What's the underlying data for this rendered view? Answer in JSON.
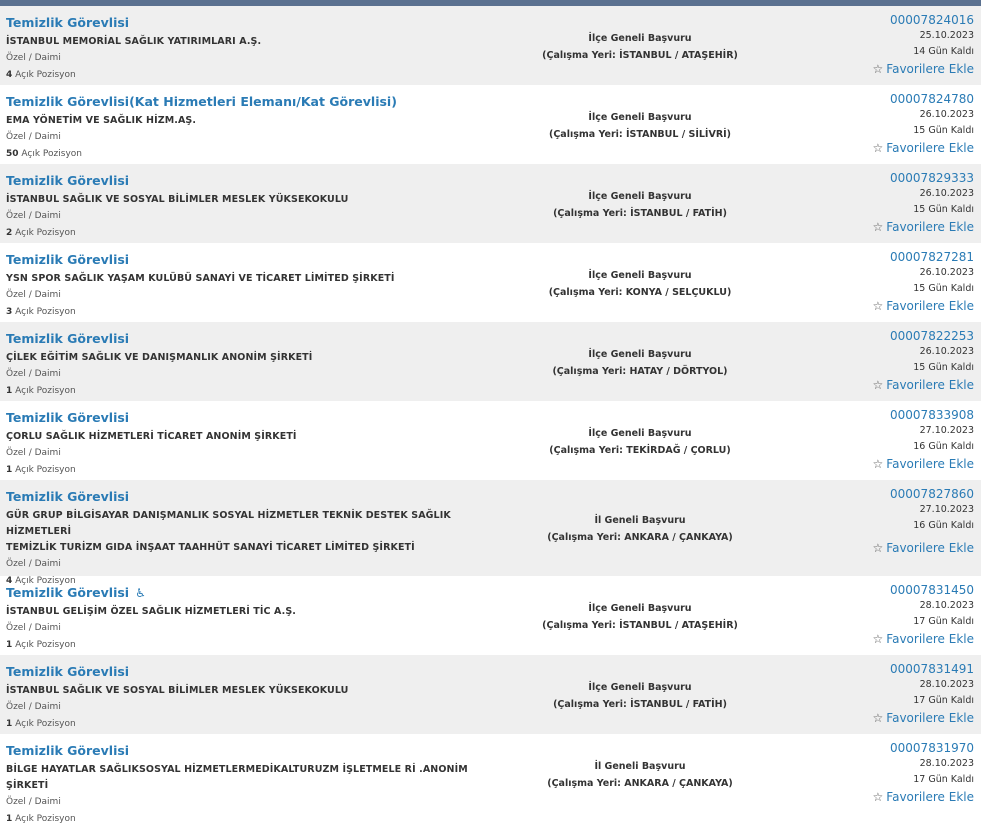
{
  "list": {
    "fav_label": "Favorilere Ekle",
    "acik_pozisyon_label": "Açık Pozisyon",
    "rows": [
      {
        "title": "Temizlik Görevlisi",
        "company": [
          "İSTANBUL MEMORİAL SAĞLIK YATIRIMLARI A.Ş."
        ],
        "type": "Özel / Daimi",
        "count": "4",
        "scope": "İlçe Geneli Başvuru",
        "location": "(Çalışma Yeri: İSTANBUL / ATAŞEHİR)",
        "ilan_no": "00007824016",
        "date": "25.10.2023",
        "remaining": "14 Gün Kaldı",
        "accessible": false
      },
      {
        "title": "Temizlik Görevlisi(Kat Hizmetleri Elemanı/Kat Görevlisi)",
        "company": [
          "EMA YÖNETİM VE SAĞLIK HİZM.AŞ."
        ],
        "type": "Özel / Daimi",
        "count": "50",
        "scope": "İlçe Geneli Başvuru",
        "location": "(Çalışma Yeri: İSTANBUL / SİLİVRİ)",
        "ilan_no": "00007824780",
        "date": "26.10.2023",
        "remaining": "15 Gün Kaldı",
        "accessible": false
      },
      {
        "title": "Temizlik Görevlisi",
        "company": [
          "İSTANBUL SAĞLIK VE SOSYAL BİLİMLER MESLEK YÜKSEKOKULU"
        ],
        "type": "Özel / Daimi",
        "count": "2",
        "scope": "İlçe Geneli Başvuru",
        "location": "(Çalışma Yeri: İSTANBUL / FATİH)",
        "ilan_no": "00007829333",
        "date": "26.10.2023",
        "remaining": "15 Gün Kaldı",
        "accessible": false
      },
      {
        "title": "Temizlik Görevlisi",
        "company": [
          "YSN SPOR SAĞLIK YAŞAM KULÜBÜ SANAYİ VE TİCARET LİMİTED ŞİRKETİ"
        ],
        "type": "Özel / Daimi",
        "count": "3",
        "scope": "İlçe Geneli Başvuru",
        "location": "(Çalışma Yeri: KONYA / SELÇUKLU)",
        "ilan_no": "00007827281",
        "date": "26.10.2023",
        "remaining": "15 Gün Kaldı",
        "accessible": false
      },
      {
        "title": "Temizlik Görevlisi",
        "company": [
          "ÇİLEK EĞİTİM SAĞLIK VE DANIŞMANLIK ANONİM ŞİRKETİ"
        ],
        "type": "Özel / Daimi",
        "count": "1",
        "scope": "İlçe Geneli Başvuru",
        "location": "(Çalışma Yeri: HATAY / DÖRTYOL)",
        "ilan_no": "00007822253",
        "date": "26.10.2023",
        "remaining": "15 Gün Kaldı",
        "accessible": false
      },
      {
        "title": "Temizlik Görevlisi",
        "company": [
          "ÇORLU SAĞLIK HİZMETLERİ TİCARET ANONİM ŞİRKETİ"
        ],
        "type": "Özel / Daimi",
        "count": "1",
        "scope": "İlçe Geneli Başvuru",
        "location": "(Çalışma Yeri: TEKİRDAĞ / ÇORLU)",
        "ilan_no": "00007833908",
        "date": "27.10.2023",
        "remaining": "16 Gün Kaldı",
        "accessible": false
      },
      {
        "title": "Temizlik Görevlisi",
        "company": [
          "GÜR GRUP BİLGİSAYAR DANIŞMANLIK SOSYAL HİZMETLER TEKNİK DESTEK SAĞLIK HİZMETLERİ",
          "TEMİZLİK TURİZM GIDA İNŞAAT TAAHHÜT SANAYİ TİCARET LİMİTED ŞİRKETİ"
        ],
        "type": "Özel / Daimi",
        "count": "4",
        "scope": "İl Geneli Başvuru",
        "location": "(Çalışma Yeri: ANKARA / ÇANKAYA)",
        "ilan_no": "00007827860",
        "date": "27.10.2023",
        "remaining": "16 Gün Kaldı",
        "accessible": false
      },
      {
        "title": "Temizlik Görevlisi",
        "company": [
          "İSTANBUL GELİŞİM ÖZEL SAĞLIK HİZMETLERİ TİC A.Ş."
        ],
        "type": "Özel / Daimi",
        "count": "1",
        "scope": "İlçe Geneli Başvuru",
        "location": "(Çalışma Yeri: İSTANBUL / ATAŞEHİR)",
        "ilan_no": "00007831450",
        "date": "28.10.2023",
        "remaining": "17 Gün Kaldı",
        "accessible": true
      },
      {
        "title": "Temizlik Görevlisi",
        "company": [
          "İSTANBUL SAĞLIK VE SOSYAL BİLİMLER MESLEK YÜKSEKOKULU"
        ],
        "type": "Özel / Daimi",
        "count": "1",
        "scope": "İlçe Geneli Başvuru",
        "location": "(Çalışma Yeri: İSTANBUL / FATİH)",
        "ilan_no": "00007831491",
        "date": "28.10.2023",
        "remaining": "17 Gün Kaldı",
        "accessible": false
      },
      {
        "title": "Temizlik Görevlisi",
        "company": [
          "BİLGE HAYATLAR SAĞLIKSOSYAL HİZMETLERMEDİKALTURUZM İŞLETMELE Rİ .ANONİM ŞİRKETİ"
        ],
        "type": "Özel / Daimi",
        "count": "1",
        "scope": "İl Geneli Başvuru",
        "location": "(Çalışma Yeri: ANKARA / ÇANKAYA)",
        "ilan_no": "00007831970",
        "date": "28.10.2023",
        "remaining": "17 Gün Kaldı",
        "accessible": false
      }
    ]
  }
}
